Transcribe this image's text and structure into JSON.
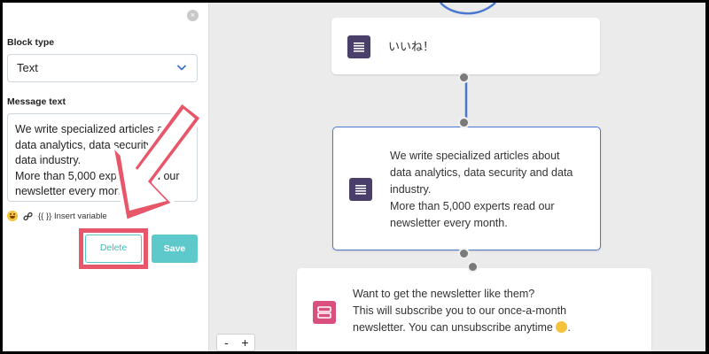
{
  "panel": {
    "close_glyph": "×",
    "block_type_label": "Block type",
    "block_type_value": "Text",
    "message_label": "Message text",
    "message_value": "We write specialized articles about\ndata analytics, data security and\ndata industry.\nMore than 5,000 experts read our\nnewsletter every month.",
    "insert_variable": "{{ }} Insert variable",
    "delete_label": "Delete",
    "save_label": "Save"
  },
  "canvas": {
    "nodes": [
      {
        "text": "いいね！",
        "icon": "text-block-icon"
      },
      {
        "text": "We write specialized articles about\ndata analytics, data security and data\nindustry.\nMore than 5,000 experts read our\nnewsletter every month.",
        "icon": "text-block-icon"
      },
      {
        "text": "Want to get the newsletter like them?\nThis will subscribe you to our once-a-month\nnewsletter. You can unsubscribe anytime ",
        "icon": "form-block-icon"
      }
    ],
    "zoom_out": "-",
    "zoom_in": "+"
  },
  "colors": {
    "accent_teal": "#5ec9ca",
    "annotation_red": "#e8566a",
    "selected_border": "#4a78d0",
    "text_block_icon": "#4a3f6b",
    "form_block_icon": "#d94f7d",
    "connector": "#4a78d0"
  }
}
